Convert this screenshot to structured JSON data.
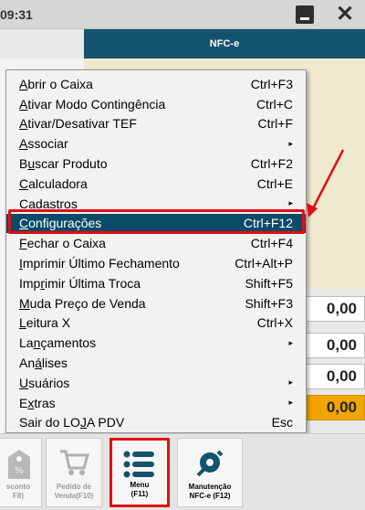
{
  "titlebar": {
    "clock": "09:31"
  },
  "header": {
    "banner": "NFC-e"
  },
  "menu": {
    "items": [
      {
        "pre": "",
        "u": "A",
        "post": "brir o Caixa",
        "shortcut": "Ctrl+F3",
        "submenu": false
      },
      {
        "pre": "",
        "u": "A",
        "post": "tivar Modo Contingência",
        "shortcut": "Ctrl+C",
        "submenu": false
      },
      {
        "pre": "",
        "u": "A",
        "post": "tivar/Desativar TEF",
        "shortcut": "Ctrl+F",
        "submenu": false
      },
      {
        "pre": "",
        "u": "A",
        "post": "ssociar",
        "shortcut": "",
        "submenu": true
      },
      {
        "pre": "B",
        "u": "u",
        "post": "scar Produto",
        "shortcut": "Ctrl+F2",
        "submenu": false
      },
      {
        "pre": "",
        "u": "C",
        "post": "alculadora",
        "shortcut": "Ctrl+E",
        "submenu": false
      },
      {
        "pre": "Ca",
        "u": "d",
        "post": "astros",
        "shortcut": "",
        "submenu": true
      },
      {
        "pre": "",
        "u": "C",
        "post": "onfigurações",
        "shortcut": "Ctrl+F12",
        "submenu": false,
        "selected": true
      },
      {
        "pre": "",
        "u": "F",
        "post": "echar o Caixa",
        "shortcut": "Ctrl+F4",
        "submenu": false
      },
      {
        "pre": "",
        "u": "I",
        "post": "mprimir Último Fechamento",
        "shortcut": "Ctrl+Alt+P",
        "submenu": false
      },
      {
        "pre": "Imp",
        "u": "r",
        "post": "imir Última Troca",
        "shortcut": "Shift+F5",
        "submenu": false
      },
      {
        "pre": "",
        "u": "M",
        "post": "uda Preço de Venda",
        "shortcut": "Shift+F3",
        "submenu": false
      },
      {
        "pre": "",
        "u": "L",
        "post": "eitura X",
        "shortcut": "Ctrl+X",
        "submenu": false
      },
      {
        "pre": "La",
        "u": "n",
        "post": "çamentos",
        "shortcut": "",
        "submenu": true
      },
      {
        "pre": "An",
        "u": "á",
        "post": "lises",
        "shortcut": "",
        "submenu": false
      },
      {
        "pre": "",
        "u": "U",
        "post": "suários",
        "shortcut": "",
        "submenu": true
      },
      {
        "pre": "E",
        "u": "x",
        "post": "tras",
        "shortcut": "",
        "submenu": true
      },
      {
        "pre": "Sair do LO",
        "u": "J",
        "post": "A PDV",
        "shortcut": "Esc",
        "submenu": false
      }
    ]
  },
  "values": [
    "0,00",
    "0,00",
    "0,00",
    "0,00"
  ],
  "bottom_buttons": [
    {
      "line1": "sconto",
      "line2": "F8)"
    },
    {
      "line1": "Pedido de",
      "line2": "Venda(F10)"
    },
    {
      "line1": "Menu",
      "line2": "(F11)"
    },
    {
      "line1": "Manutenção",
      "line2": "NFC-e (F12)"
    }
  ],
  "colors": {
    "accent": "#14536e",
    "selected": "#0b4a68",
    "highlight": "#e01010",
    "total": "#f0a500"
  }
}
